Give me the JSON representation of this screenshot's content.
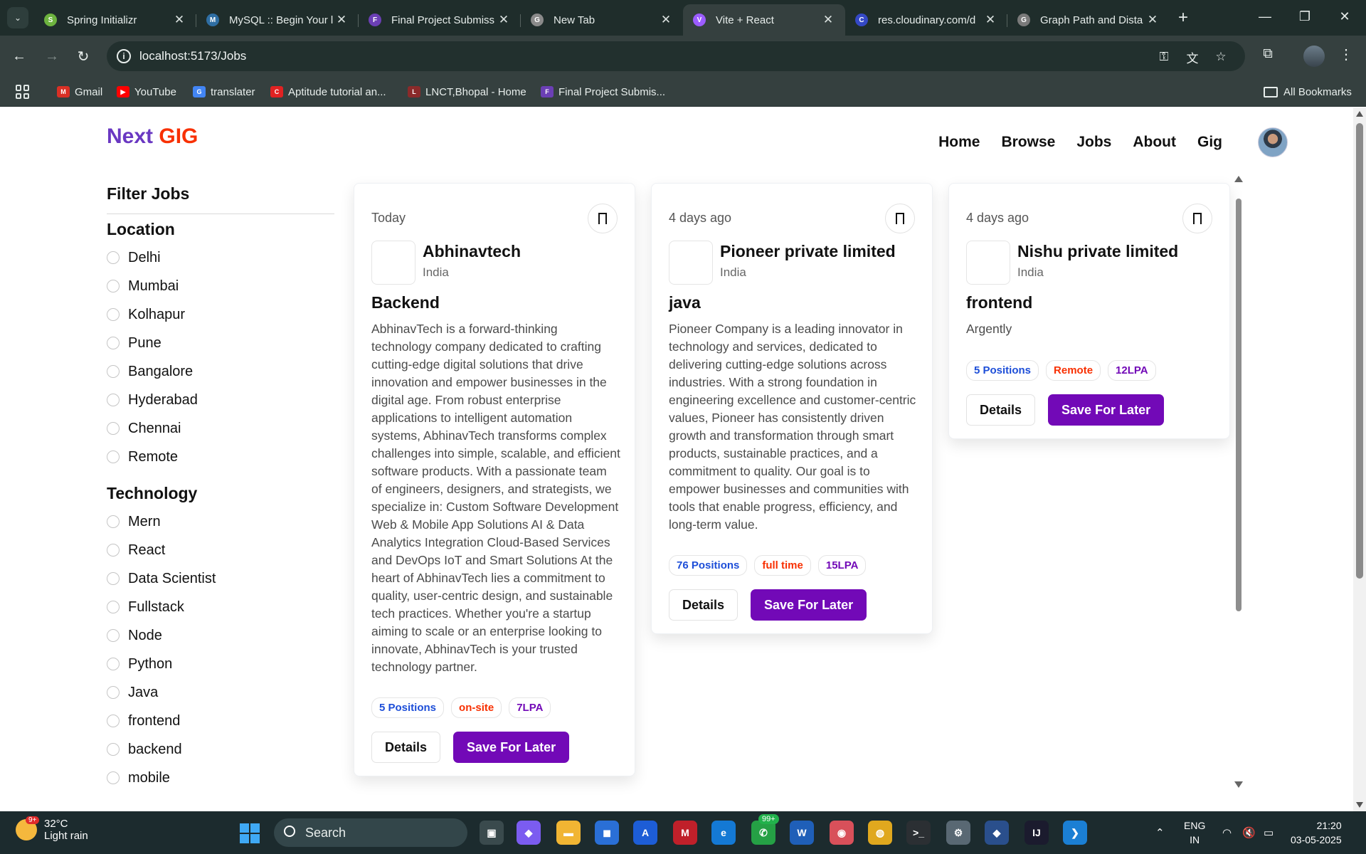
{
  "browser": {
    "tabs": [
      {
        "title": "Spring Initializr",
        "color": "#6db33f",
        "glyph": "S",
        "active": false
      },
      {
        "title": "MySQL :: Begin Your l",
        "color": "#2f6ea3",
        "glyph": "M",
        "active": false
      },
      {
        "title": "Final Project Submiss",
        "color": "#6b3fb5",
        "glyph": "F",
        "active": false
      },
      {
        "title": "New Tab",
        "color": "#8a8a8a",
        "glyph": "G",
        "active": false
      },
      {
        "title": "Vite + React",
        "color": "#9b5cff",
        "glyph": "V",
        "active": true
      },
      {
        "title": "res.cloudinary.com/d",
        "color": "#3448c5",
        "glyph": "C",
        "active": false
      },
      {
        "title": "Graph Path and Dista",
        "color": "#7a7a7a",
        "glyph": "G",
        "active": false
      }
    ],
    "url": "localhost:5173/Jobs",
    "bookmarks": [
      {
        "label": "Gmail",
        "color": "#d93025",
        "glyph": "M"
      },
      {
        "label": "YouTube",
        "color": "#ff0000",
        "glyph": "▶"
      },
      {
        "label": "translater",
        "color": "#4285f4",
        "glyph": "G"
      },
      {
        "label": "Aptitude tutorial an...",
        "color": "#e02222",
        "glyph": "C"
      },
      {
        "label": "LNCT,Bhopal - Home",
        "color": "#8b2a2a",
        "glyph": "L"
      },
      {
        "label": "Final Project Submis...",
        "color": "#6b3fb5",
        "glyph": "F"
      }
    ],
    "all_bookmarks": "All Bookmarks"
  },
  "site": {
    "logo_part1": "Next ",
    "logo_part2": "GIG",
    "nav": [
      "Home",
      "Browse",
      "Jobs",
      "About",
      "Gig"
    ]
  },
  "filters": {
    "title": "Filter Jobs",
    "groups": [
      {
        "title": "Location",
        "options": [
          "Delhi",
          "Mumbai",
          "Kolhapur",
          "Pune",
          "Bangalore",
          "Hyderabad",
          "Chennai",
          "Remote"
        ]
      },
      {
        "title": "Technology",
        "options": [
          "Mern",
          "React",
          "Data Scientist",
          "Fullstack",
          "Node",
          "Python",
          "Java",
          "frontend",
          "backend",
          "mobile"
        ]
      }
    ]
  },
  "jobs": [
    {
      "posted": "Today",
      "company": "Abhinavtech",
      "country": "India",
      "title": "Backend",
      "description": "AbhinavTech is a forward-thinking technology company dedicated to crafting cutting-edge digital solutions that drive innovation and empower businesses in the digital age. From robust enterprise applications to intelligent automation systems, AbhinavTech transforms complex challenges into simple, scalable, and efficient software products. With a passionate team of engineers, designers, and strategists, we specialize in: Custom Software Development Web & Mobile App Solutions AI & Data Analytics Integration Cloud-Based Services and DevOps IoT and Smart Solutions At the heart of AbhinavTech lies a commitment to quality, user-centric design, and sustainable tech practices. Whether you're a startup aiming to scale or an enterprise looking to innovate, AbhinavTech is your trusted technology partner.",
      "positions": "5 Positions",
      "job_type": "on-site",
      "salary": "7LPA",
      "details_label": "Details",
      "save_label": "Save For Later"
    },
    {
      "posted": "4 days ago",
      "company": "Pioneer private limited",
      "country": "India",
      "title": "java",
      "description": "Pioneer Company is a leading innovator in technology and services, dedicated to delivering cutting-edge solutions across industries. With a strong foundation in engineering excellence and customer-centric values, Pioneer has consistently driven growth and transformation through smart products, sustainable practices, and a commitment to quality. Our goal is to empower businesses and communities with tools that enable progress, efficiency, and long-term value.",
      "positions": "76 Positions",
      "job_type": "full time",
      "salary": "15LPA",
      "details_label": "Details",
      "save_label": "Save For Later"
    },
    {
      "posted": "4 days ago",
      "company": "Nishu private limited",
      "country": "India",
      "title": "frontend",
      "description": "Argently",
      "positions": "5 Positions",
      "job_type": "Remote",
      "salary": "12LPA",
      "details_label": "Details",
      "save_label": "Save For Later"
    }
  ],
  "taskbar": {
    "temperature": "32°C",
    "weather": "Light rain",
    "weather_badge": "9+",
    "search_label": "Search",
    "whatsapp_badge": "99+",
    "lang_line1": "ENG",
    "lang_line2": "IN",
    "time": "21:20",
    "date": "03-05-2025"
  }
}
